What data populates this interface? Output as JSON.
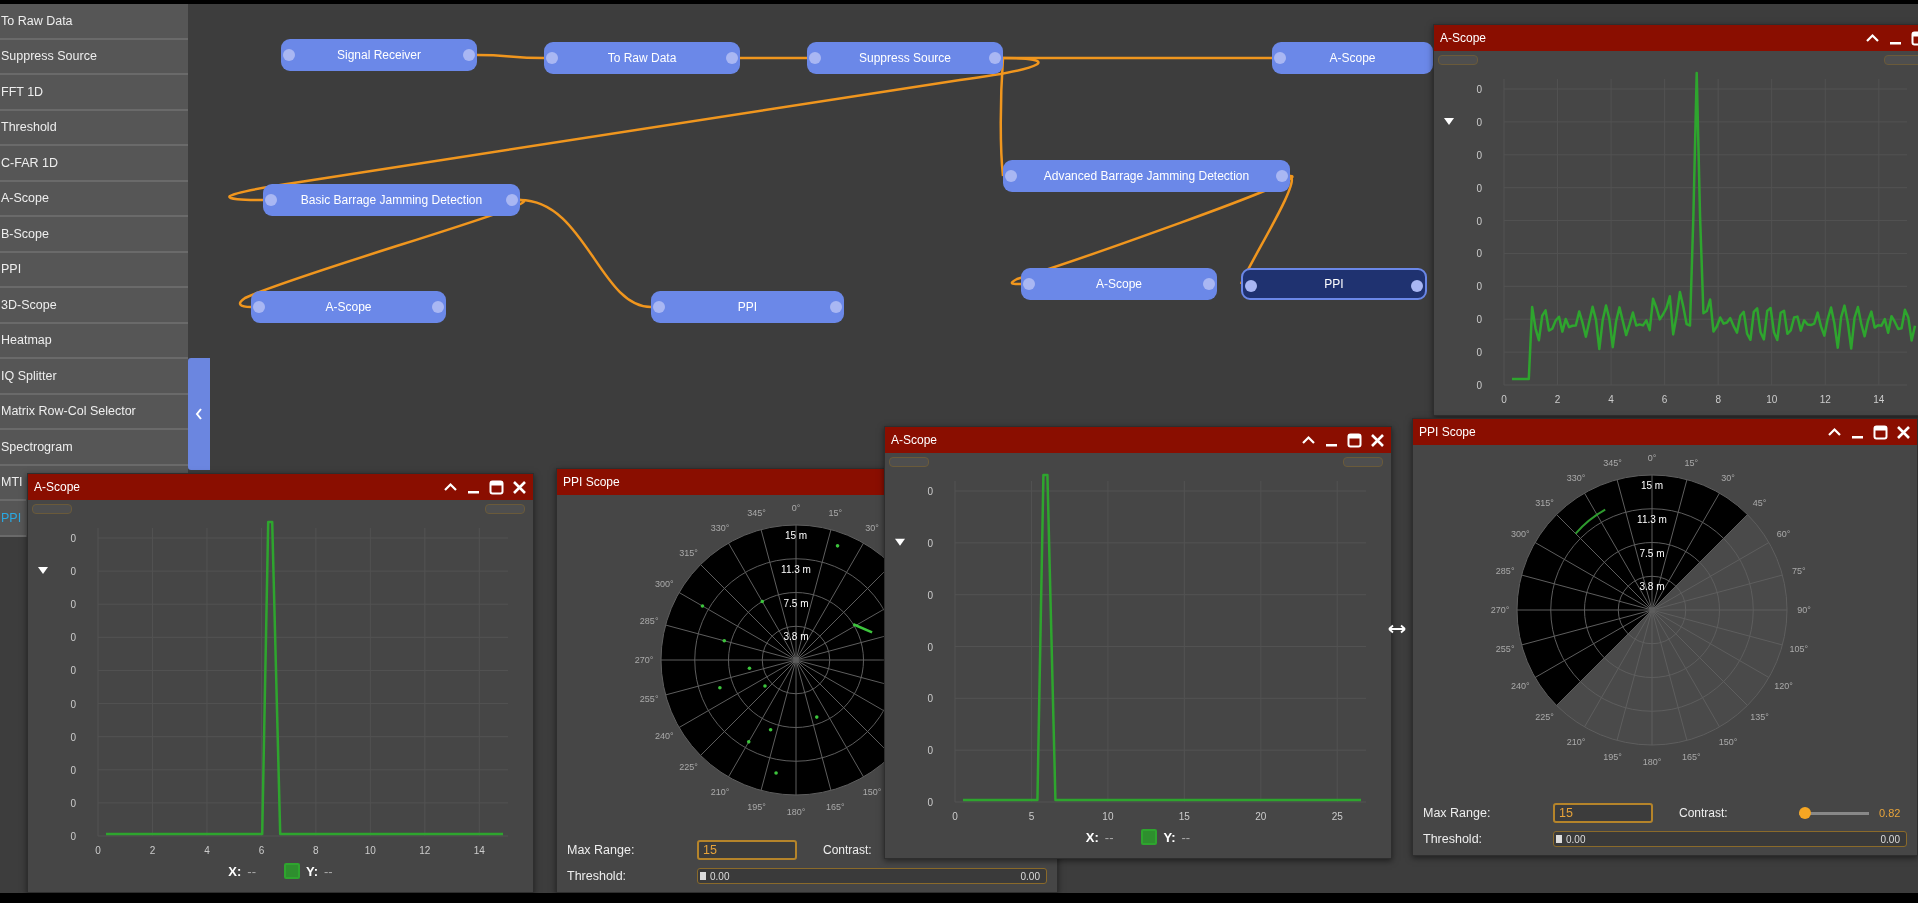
{
  "sidebar": {
    "items": [
      {
        "label": "To Raw Data",
        "selected": false
      },
      {
        "label": "Suppress Source",
        "selected": false
      },
      {
        "label": "FFT 1D",
        "selected": false
      },
      {
        "label": "Threshold",
        "selected": false
      },
      {
        "label": "C-FAR 1D",
        "selected": false
      },
      {
        "label": "A-Scope",
        "selected": false
      },
      {
        "label": "B-Scope",
        "selected": false
      },
      {
        "label": "PPI",
        "selected": false
      },
      {
        "label": "3D-Scope",
        "selected": false
      },
      {
        "label": "Heatmap",
        "selected": false
      },
      {
        "label": "IQ Splitter",
        "selected": false
      },
      {
        "label": "Matrix Row-Col Selector",
        "selected": false
      },
      {
        "label": "Spectrogram",
        "selected": false
      },
      {
        "label": "MTI",
        "selected": false
      },
      {
        "label": "PPI",
        "selected": true
      }
    ]
  },
  "nodes": [
    {
      "label": "Signal Receiver",
      "selected": false
    },
    {
      "label": "To Raw Data",
      "selected": false
    },
    {
      "label": "Suppress Source",
      "selected": false
    },
    {
      "label": "A-Scope",
      "selected": false
    },
    {
      "label": "Basic Barrage Jamming Detection",
      "selected": false
    },
    {
      "label": "Advanced Barrage Jamming Detection",
      "selected": false
    },
    {
      "label": "A-Scope",
      "selected": false
    },
    {
      "label": "PPI",
      "selected": false
    },
    {
      "label": "A-Scope",
      "selected": false
    },
    {
      "label": "PPI",
      "selected": true
    }
  ],
  "windows": [
    {
      "kind": "scope",
      "title": "A-Scope",
      "controls": [
        {
          "kind": "collapse"
        },
        {
          "kind": "minimize"
        },
        {
          "kind": "maximize"
        }
      ],
      "trace": {
        "kind": "noisy_peak"
      },
      "y_ticks": [
        "0",
        "0",
        "0",
        "0",
        "0",
        "0",
        "0",
        "0",
        "0",
        "0"
      ],
      "x_ticks": [
        "0",
        "2",
        "4",
        "6",
        "8",
        "10",
        "12",
        "14"
      ]
    },
    {
      "kind": "ppi",
      "title": "PPI Scope",
      "controls": [
        {
          "kind": "collapse"
        },
        {
          "kind": "minimize"
        },
        {
          "kind": "maximize"
        },
        {
          "kind": "close"
        }
      ],
      "radar": {
        "kind": "sector"
      },
      "left_angle_labels": [
        "345°",
        "330°",
        "315°",
        "300°",
        "285°",
        "270°",
        "255°",
        "240°",
        "225°",
        "210°",
        "195°"
      ],
      "upper_right_angle_labels": [
        "0°",
        "15°",
        "30°",
        "45°",
        "60°",
        "75°",
        "90°",
        "105°",
        "120°",
        "135°",
        "150°",
        "165°",
        "180°"
      ],
      "range_labels": [
        "15 m",
        "11.3 m",
        "7.5 m",
        "3.8 m"
      ],
      "max_range": {
        "label": "Max Range:",
        "value": "15"
      },
      "contrast": {
        "label": "Contrast:",
        "value": "0.82",
        "level": 0.08
      },
      "threshold": {
        "label": "Threshold:",
        "min_value": "0.00",
        "max_value": "0.00",
        "level": 0
      }
    },
    {
      "kind": "scope",
      "title": "A-Scope",
      "controls": [
        {
          "kind": "collapse"
        },
        {
          "kind": "minimize"
        },
        {
          "kind": "maximize"
        },
        {
          "kind": "close"
        }
      ],
      "trace": {
        "kind": "single_peak"
      },
      "y_ticks": [
        "0",
        "0",
        "0",
        "0",
        "0",
        "0",
        "0",
        "0",
        "0",
        "0"
      ],
      "x_ticks": [
        "0",
        "2",
        "4",
        "6",
        "8",
        "10",
        "12",
        "14"
      ],
      "legend": [
        {
          "kind": "plain",
          "label": "X:",
          "value": "--"
        },
        {
          "kind": "toggle",
          "label": "Y:",
          "value": "--",
          "checked": true
        }
      ]
    },
    {
      "kind": "ppi",
      "title": "PPI Scope",
      "radar": {
        "kind": "full_disc"
      },
      "left_angle_labels": [
        "345°",
        "330°",
        "315°",
        "300°",
        "285°",
        "270°",
        "255°",
        "240°",
        "225°",
        "210°",
        "195°"
      ],
      "upper_right_angle_labels": [
        "0°",
        "15°",
        "30°"
      ],
      "lower_right_angle_labels": [
        "150°",
        "165°",
        "180°"
      ],
      "range_labels": [
        "15 m",
        "11.3 m",
        "7.5 m",
        "3.8 m"
      ],
      "max_range": {
        "label": "Max Range:",
        "value": "15"
      },
      "contrast": {
        "label": "Contrast:"
      },
      "threshold": {
        "label": "Threshold:",
        "min_value": "0.00",
        "max_value": "0.00",
        "level": 0
      }
    },
    {
      "kind": "scope",
      "title": "A-Scope",
      "controls": [
        {
          "kind": "collapse"
        },
        {
          "kind": "minimize"
        },
        {
          "kind": "maximize"
        },
        {
          "kind": "close"
        }
      ],
      "trace": {
        "kind": "single_peak"
      },
      "y_ticks": [
        "0",
        "0",
        "0",
        "0",
        "0",
        "0",
        "0"
      ],
      "x_ticks": [
        "0",
        "5",
        "10",
        "15",
        "20",
        "25"
      ],
      "legend": [
        {
          "kind": "plain",
          "label": "X:",
          "value": "--"
        },
        {
          "kind": "toggle",
          "label": "Y:",
          "value": "--",
          "checked": true
        }
      ]
    }
  ]
}
